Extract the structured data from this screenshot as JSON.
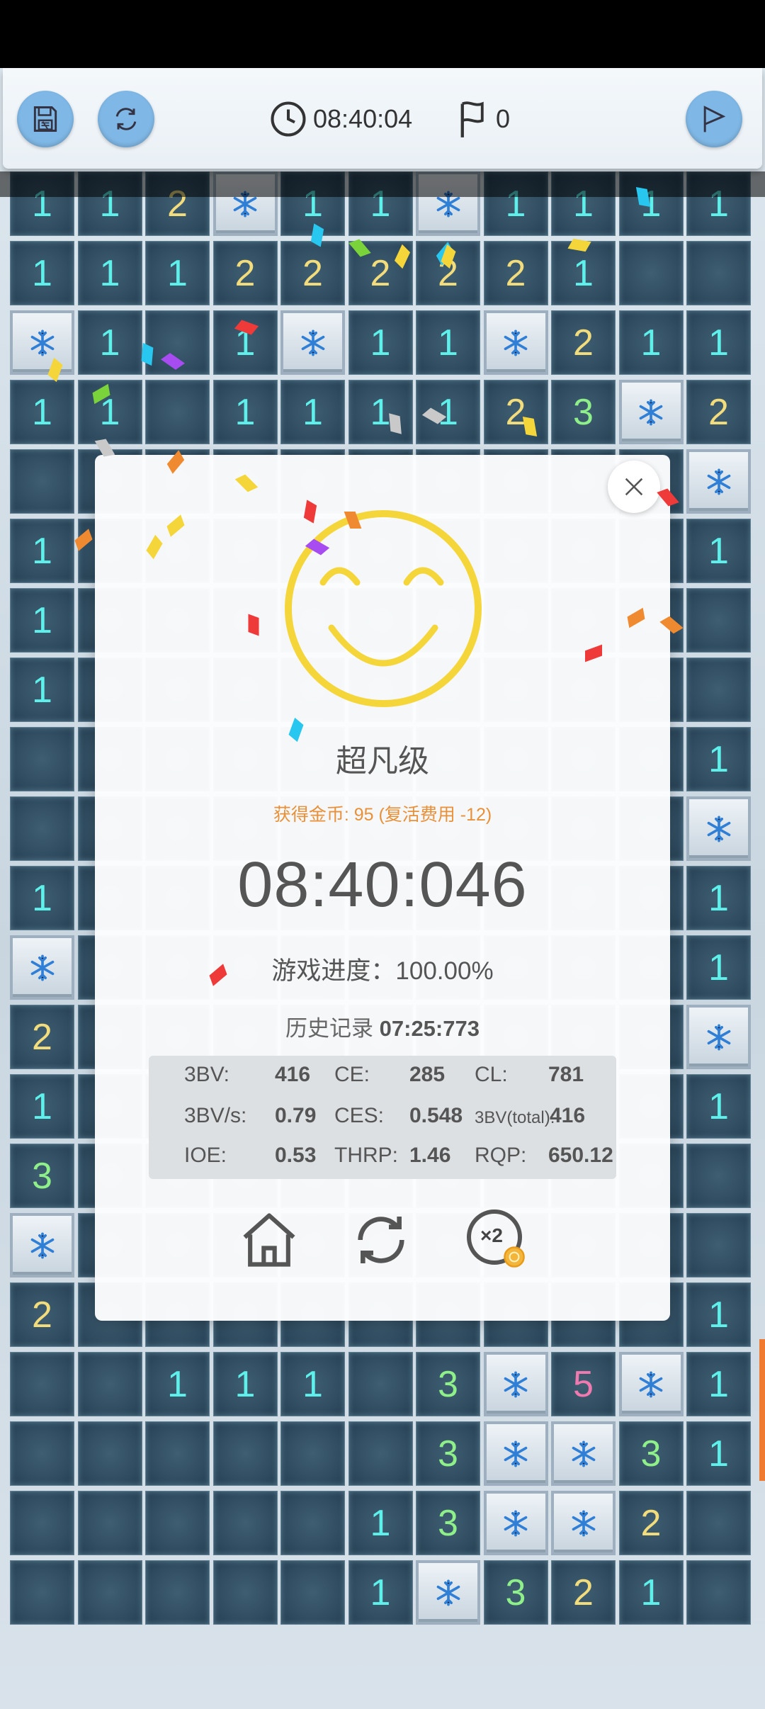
{
  "toolbar": {
    "save_icon": "save-icon",
    "restart_icon": "restart-icon",
    "timer": "08:40:04",
    "flags": "0",
    "play_icon": "flag-play-icon"
  },
  "board": {
    "rows": [
      [
        "1",
        "1",
        "2",
        "*",
        "1",
        "1",
        "*",
        "1",
        "1",
        "1",
        "1"
      ],
      [
        "1",
        "1",
        "1",
        "2",
        "2",
        "2",
        "2",
        "2",
        "1",
        "",
        ""
      ],
      [
        "*",
        "1",
        "",
        "1",
        "*",
        "1",
        "1",
        "*",
        "2",
        "1",
        "1"
      ],
      [
        "1",
        "1",
        "",
        "1",
        "1",
        "1",
        "1",
        "2",
        "3",
        "*",
        "2"
      ],
      [
        "",
        "",
        "",
        "",
        "",
        "",
        "",
        "",
        "",
        "",
        "*"
      ],
      [
        "1",
        "",
        "",
        "",
        "",
        "",
        "",
        "",
        "",
        "",
        "1"
      ],
      [
        "1",
        "",
        "",
        "",
        "",
        "",
        "",
        "",
        "",
        "",
        ""
      ],
      [
        "1",
        "",
        "",
        "",
        "",
        "",
        "",
        "",
        "",
        "",
        ""
      ],
      [
        "",
        "",
        "",
        "",
        "",
        "",
        "",
        "",
        "",
        "",
        "1"
      ],
      [
        "",
        "",
        "",
        "",
        "",
        "",
        "",
        "",
        "",
        "",
        "*"
      ],
      [
        "1",
        "",
        "",
        "",
        "",
        "",
        "",
        "",
        "",
        "",
        "1"
      ],
      [
        "*",
        "",
        "",
        "",
        "",
        "",
        "",
        "",
        "",
        "",
        "1"
      ],
      [
        "2",
        "",
        "",
        "",
        "",
        "",
        "",
        "",
        "",
        "",
        "*"
      ],
      [
        "1",
        "",
        "",
        "",
        "",
        "",
        "",
        "",
        "",
        "",
        "1"
      ],
      [
        "3",
        "",
        "",
        "",
        "",
        "",
        "",
        "",
        "",
        "",
        ""
      ],
      [
        "*",
        "",
        "",
        "",
        "",
        "",
        "",
        "",
        "",
        "",
        ""
      ],
      [
        "2",
        "",
        "",
        "",
        "",
        "",
        "",
        "",
        "",
        "",
        "1"
      ],
      [
        "",
        "",
        "1",
        "1",
        "1",
        "",
        "3",
        "*",
        "5",
        "*",
        "1"
      ],
      [
        "",
        "",
        "",
        "",
        "",
        "",
        "3",
        "*",
        "*",
        "3",
        "1"
      ],
      [
        "",
        "",
        "",
        "",
        "",
        "1",
        "3",
        "*",
        "*",
        "2",
        ""
      ],
      [
        "",
        "",
        "",
        "",
        "",
        "1",
        "*",
        "3",
        "2",
        "1",
        ""
      ]
    ]
  },
  "result": {
    "rank": "超凡级",
    "coins": "获得金币: 95 (复活费用 -12)",
    "time": "08:40:046",
    "progress": "游戏进度：100.00%",
    "history_label": "历史记录",
    "history_value": "07:25:773",
    "stats": {
      "bv_label": "3BV:",
      "bv": "416",
      "ce_label": "CE:",
      "ce": "285",
      "cl_label": "CL:",
      "cl": "781",
      "bvs_label": "3BV/s:",
      "bvs": "0.79",
      "ces_label": "CES:",
      "ces": "0.548",
      "bvt_label": "3BV(total):",
      "bvt": "416",
      "ioe_label": "IOE:",
      "ioe": "0.53",
      "thrp_label": "THRP:",
      "thrp": "1.46",
      "rqp_label": "RQP:",
      "rqp": "650.12"
    },
    "double_label": "×2"
  },
  "colors": {
    "accent": "#7fb8e6",
    "smiley": "#f5d63a",
    "coins": "#e8913a",
    "number1": "#5ef0ea",
    "number2": "#f2dc7c",
    "number3": "#8ff08a",
    "number5": "#f07ab0"
  }
}
